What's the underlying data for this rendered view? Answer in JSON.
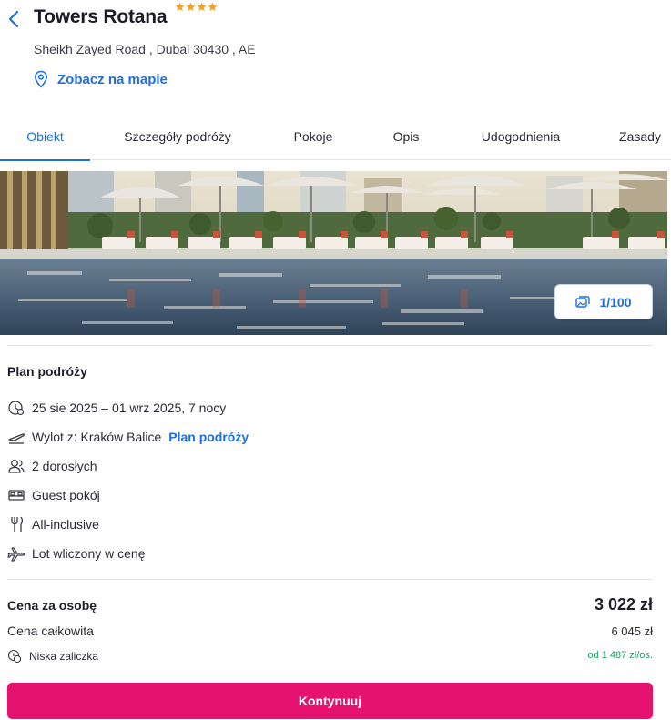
{
  "hotel": {
    "name": "Towers Rotana",
    "stars": 4,
    "address": "Sheikh Zayed Road , Dubai 30430 , AE",
    "map_link": "Zobacz na mapie"
  },
  "tabs": [
    {
      "label": "Obiekt",
      "active": true
    },
    {
      "label": "Szczegóły podróży",
      "active": false
    },
    {
      "label": "Pokoje",
      "active": false
    },
    {
      "label": "Opis",
      "active": false
    },
    {
      "label": "Udogodnienia",
      "active": false
    },
    {
      "label": "Zasady",
      "active": false
    }
  ],
  "gallery": {
    "counter": "1/100"
  },
  "trip_plan": {
    "title": "Plan podróży",
    "dates": "25 sie 2025 – 01 wrz 2025, 7 nocy",
    "departure": "Wylot z: Kraków Balice",
    "departure_link": "Plan podróży",
    "travelers": "2 dorosłych",
    "room": "Guest pokój",
    "board": "All-inclusive",
    "flight": "Lot wliczony w cenę"
  },
  "pricing": {
    "per_person_label": "Cena za osobę",
    "per_person_value": "3 022 zł",
    "total_label": "Cena całkowita",
    "total_value": "6 045 zł",
    "deposit_label": "Niska zaliczka",
    "deposit_value": "od 1 487 zł/os."
  },
  "cta": {
    "label": "Kontynuuj"
  },
  "colors": {
    "accent_blue": "#1f6fe0",
    "cta_pink": "#e5126f",
    "star_orange": "#f5a11a",
    "deposit_green": "#1aa260"
  },
  "icons": {
    "back": "chevron-left-icon",
    "map": "map-pin-icon",
    "gallery": "images-icon",
    "dates": "calendar-clock-icon",
    "departure": "plane-departure-icon",
    "travelers": "users-icon",
    "room": "bed-icon",
    "board": "fork-knife-icon",
    "flight": "plane-icon",
    "deposit": "coin-icon"
  }
}
